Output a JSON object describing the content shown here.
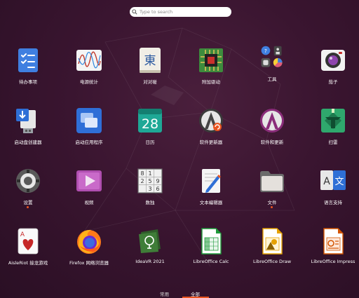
{
  "search": {
    "placeholder": "Type to search"
  },
  "apps": [
    {
      "label": "待办事项"
    },
    {
      "label": "电源统计"
    },
    {
      "label": "对对碰",
      "glyph": "東"
    },
    {
      "label": "附加驱动"
    },
    {
      "label": "工具"
    },
    {
      "label": "茄子"
    },
    {
      "label": "启动盘创建器"
    },
    {
      "label": "启动应用程序"
    },
    {
      "label": "日历",
      "glyph": "28"
    },
    {
      "label": "软件更新器"
    },
    {
      "label": "软件和更新"
    },
    {
      "label": "扫雷"
    },
    {
      "label": "设置"
    },
    {
      "label": "视频"
    },
    {
      "label": "数独",
      "cells": [
        "8",
        "1",
        "2",
        "5",
        "9",
        "3",
        "6"
      ]
    },
    {
      "label": "文本编辑器"
    },
    {
      "label": "文件"
    },
    {
      "label": "语言支持",
      "glyph_a": "A",
      "glyph_b": "文"
    },
    {
      "label": "AisleRiot 接龙游戏",
      "glyph": "A"
    },
    {
      "label": "Firefox 网络浏览器"
    },
    {
      "label": "IdeaVR 2021"
    },
    {
      "label": "LibreOffice Calc"
    },
    {
      "label": "LibreOffice Draw"
    },
    {
      "label": "LibreOffice Impress"
    }
  ],
  "tabs": {
    "frequent": "常用",
    "all": "全部"
  },
  "colors": {
    "accent": "#e95420",
    "background": "#3a1530"
  }
}
